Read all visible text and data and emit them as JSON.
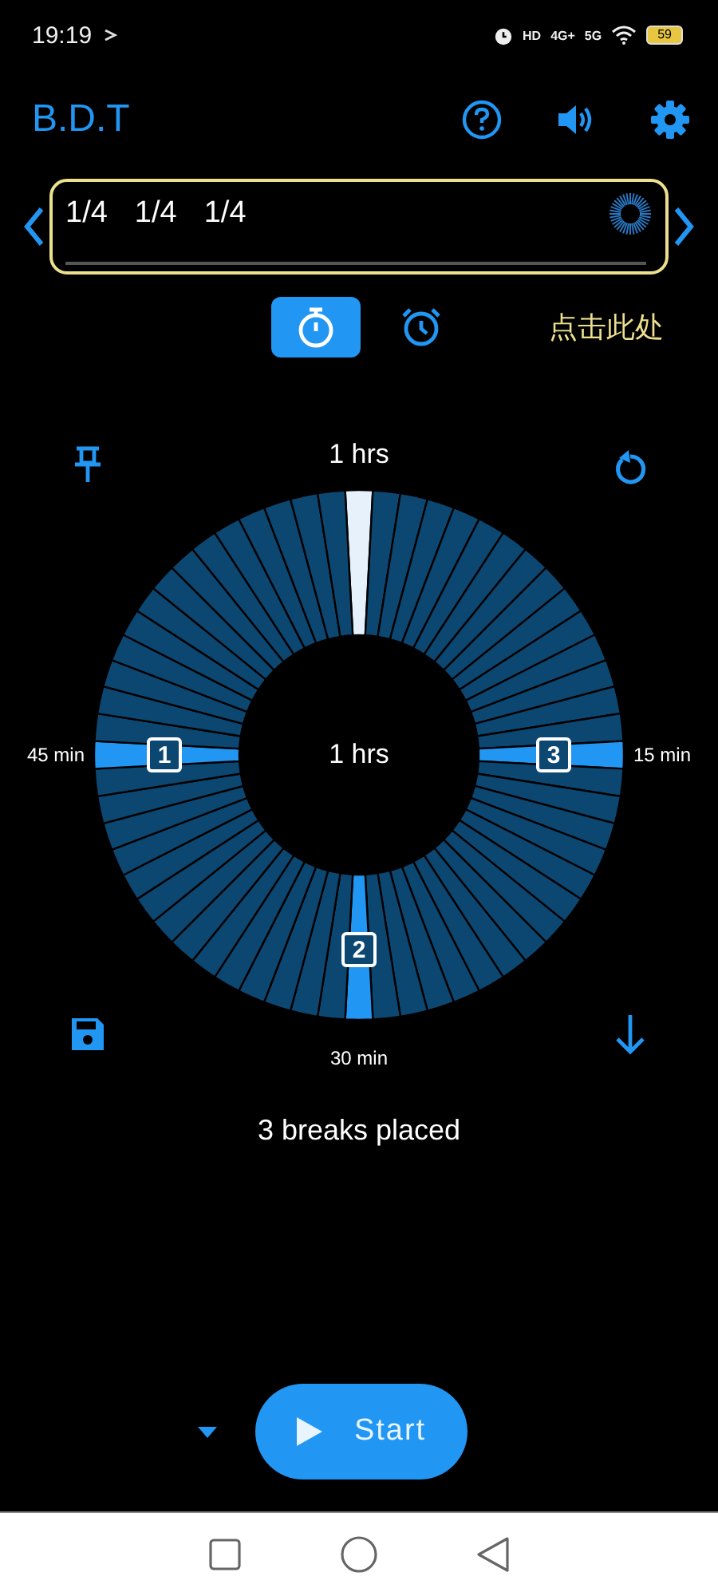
{
  "status_bar": {
    "time": "19:19",
    "network_labels": [
      "HD",
      "4G+",
      "5G"
    ],
    "battery": "59"
  },
  "app_bar": {
    "title": "B.D.T"
  },
  "sequence": {
    "fractions": [
      "1/4",
      "1/4",
      "1/4"
    ]
  },
  "modes": [
    {
      "kind": "timer",
      "selected": true
    },
    {
      "kind": "alarm",
      "selected": false
    }
  ],
  "hint": "点击此处",
  "dial": {
    "top_label": "1 hrs",
    "center_label": "1 hrs",
    "segments": [
      {
        "kind": "current"
      },
      {
        "kind": "plain"
      },
      {
        "kind": "plain"
      },
      {
        "kind": "plain"
      },
      {
        "kind": "plain"
      },
      {
        "kind": "plain"
      },
      {
        "kind": "plain"
      },
      {
        "kind": "plain"
      },
      {
        "kind": "plain"
      },
      {
        "kind": "plain"
      },
      {
        "kind": "plain"
      },
      {
        "kind": "plain"
      },
      {
        "kind": "plain"
      },
      {
        "kind": "plain"
      },
      {
        "kind": "plain"
      },
      {
        "kind": "break"
      },
      {
        "kind": "plain"
      },
      {
        "kind": "plain"
      },
      {
        "kind": "plain"
      },
      {
        "kind": "plain"
      },
      {
        "kind": "plain"
      },
      {
        "kind": "plain"
      },
      {
        "kind": "plain"
      },
      {
        "kind": "plain"
      },
      {
        "kind": "plain"
      },
      {
        "kind": "plain"
      },
      {
        "kind": "plain"
      },
      {
        "kind": "plain"
      },
      {
        "kind": "plain"
      },
      {
        "kind": "plain"
      },
      {
        "kind": "break"
      },
      {
        "kind": "plain"
      },
      {
        "kind": "plain"
      },
      {
        "kind": "plain"
      },
      {
        "kind": "plain"
      },
      {
        "kind": "plain"
      },
      {
        "kind": "plain"
      },
      {
        "kind": "plain"
      },
      {
        "kind": "plain"
      },
      {
        "kind": "plain"
      },
      {
        "kind": "plain"
      },
      {
        "kind": "plain"
      },
      {
        "kind": "plain"
      },
      {
        "kind": "plain"
      },
      {
        "kind": "plain"
      },
      {
        "kind": "break"
      },
      {
        "kind": "plain"
      },
      {
        "kind": "plain"
      },
      {
        "kind": "plain"
      },
      {
        "kind": "plain"
      },
      {
        "kind": "plain"
      },
      {
        "kind": "plain"
      },
      {
        "kind": "plain"
      },
      {
        "kind": "plain"
      },
      {
        "kind": "plain"
      },
      {
        "kind": "plain"
      },
      {
        "kind": "plain"
      },
      {
        "kind": "plain"
      },
      {
        "kind": "plain"
      },
      {
        "kind": "plain"
      }
    ],
    "breaks": [
      {
        "number": "3",
        "time": "15 min"
      },
      {
        "number": "2",
        "time": "30 min"
      },
      {
        "number": "1",
        "time": "45 min"
      }
    ]
  },
  "summary": "3 breaks placed",
  "start_button": {
    "label": "Start"
  }
}
